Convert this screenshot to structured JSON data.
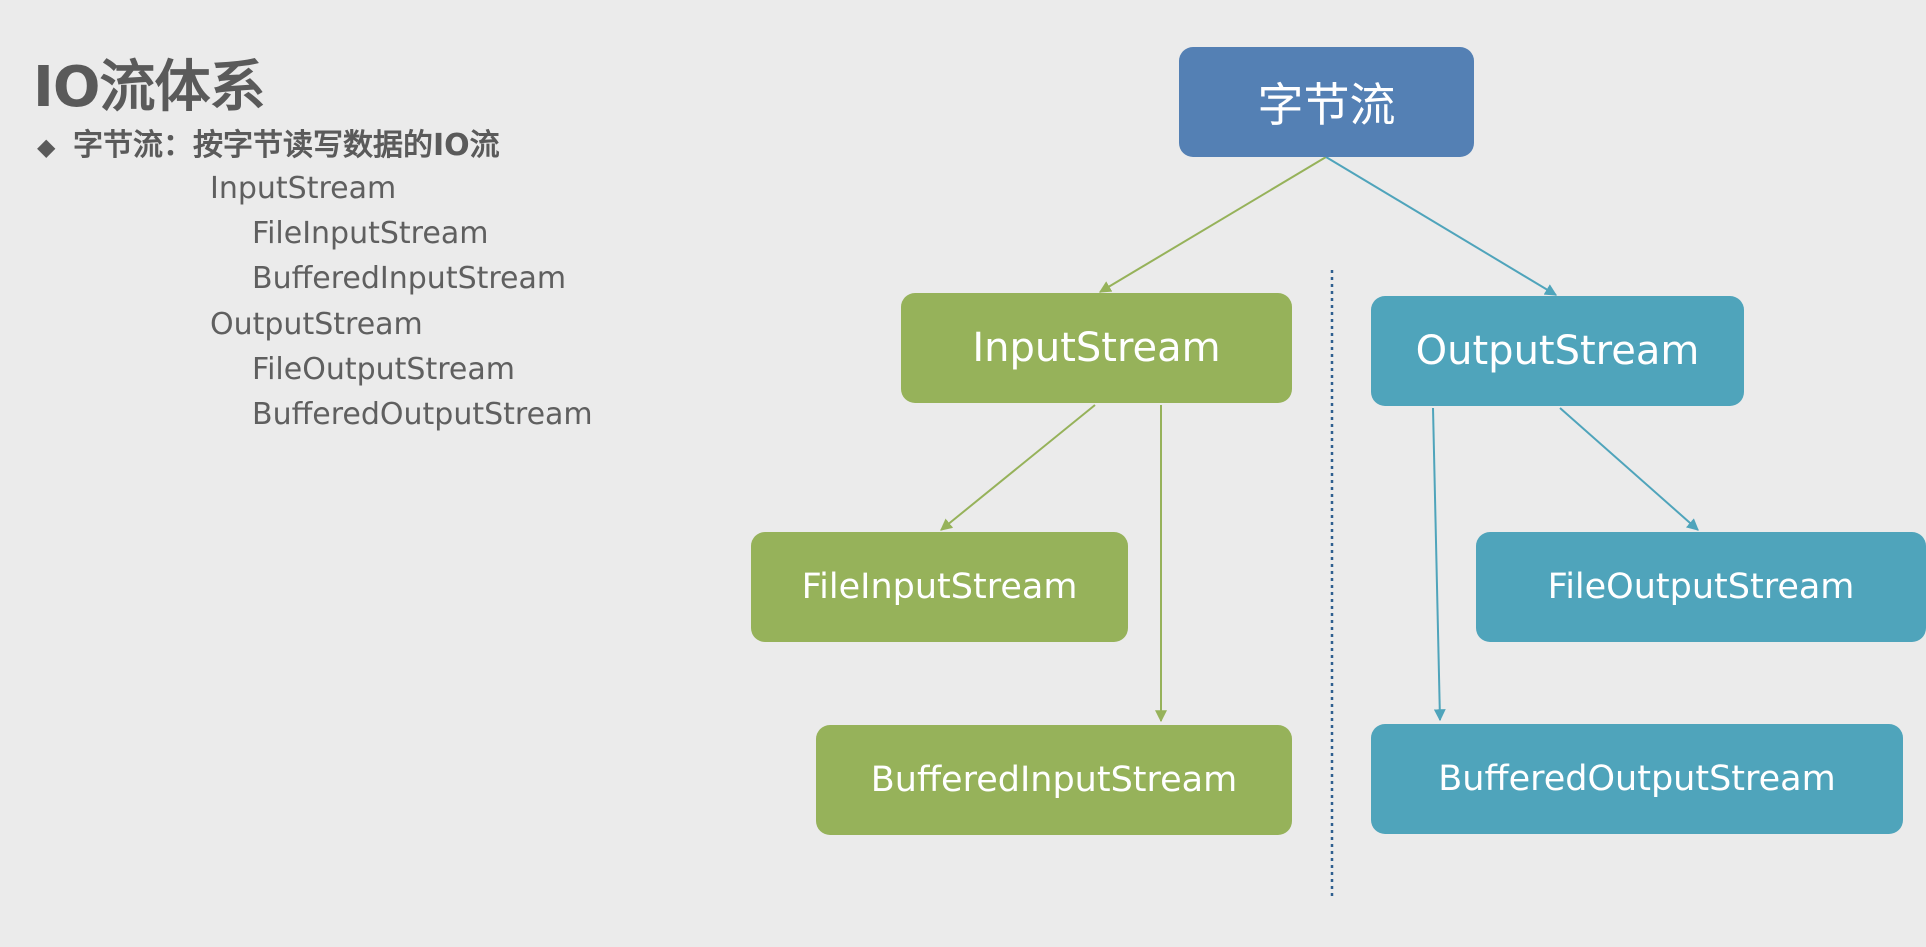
{
  "slide": {
    "title": "IO流体系",
    "bullet_symbol": "◆",
    "bullet_text": "字节流：按字节读写数据的IO流",
    "outline": [
      {
        "label": "InputStream",
        "level": 1
      },
      {
        "label": "FileInputStream",
        "level": 2
      },
      {
        "label": "BufferedInputStream",
        "level": 2
      },
      {
        "label": "OutputStream",
        "level": 1
      },
      {
        "label": "FileOutputStream",
        "level": 2
      },
      {
        "label": "BufferedOutputStream",
        "level": 2
      }
    ]
  },
  "diagram": {
    "colors": {
      "root": "#5480b4",
      "input": "#96b25a",
      "output": "#4fa4bb",
      "divider": "#2f5f8f"
    },
    "nodes": {
      "root": "字节流",
      "input_stream": "InputStream",
      "output_stream": "OutputStream",
      "file_input_stream": "FileInputStream",
      "buffered_input_stream": "BufferedInputStream",
      "file_output_stream": "FileOutputStream",
      "buffered_output_stream": "BufferedOutputStream"
    }
  }
}
